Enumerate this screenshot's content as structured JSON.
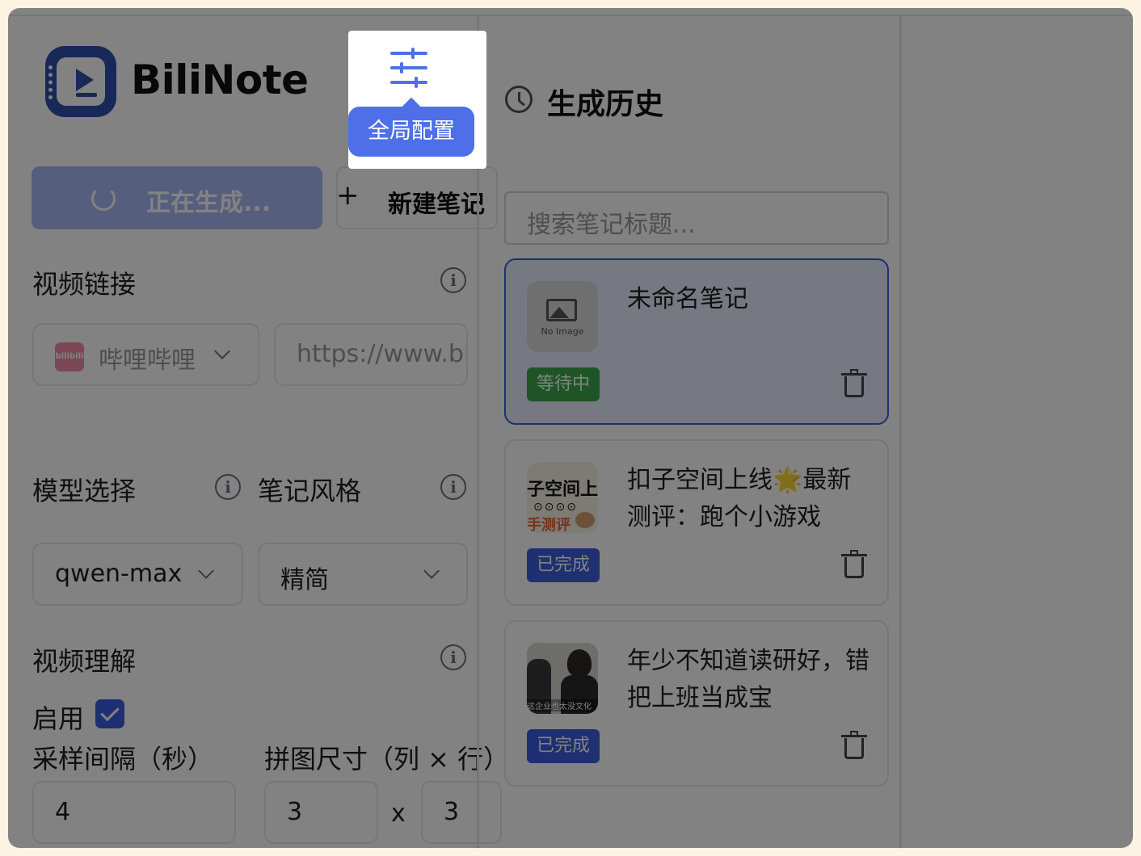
{
  "app": {
    "name": "BiliNote"
  },
  "header": {
    "settings_tooltip": "全局配置"
  },
  "actions": {
    "generating_label": "正在生成...",
    "new_note_label": "新建笔记",
    "plus": "+"
  },
  "form": {
    "video_link": {
      "label": "视频链接",
      "platform": {
        "selected": "哔哩哔哩",
        "logo_text": "bilibili"
      },
      "url_value": "https://www.bilibili.com/"
    },
    "model": {
      "label": "模型选择",
      "selected": "qwen-max"
    },
    "style": {
      "label": "笔记风格",
      "selected": "精简"
    },
    "video_understanding": {
      "label": "视频理解",
      "enable_label": "启用",
      "enabled": true,
      "interval_label": "采样间隔（秒）",
      "interval_value": "4",
      "grid_label": "拼图尺寸（列 × 行）",
      "grid_cols": "3",
      "grid_rows": "3",
      "times": "x"
    }
  },
  "history": {
    "title": "生成历史",
    "search_placeholder": "搜索笔记标题...",
    "items": [
      {
        "title": "未命名笔记",
        "status": "等待中",
        "thumb_text": "No Image"
      },
      {
        "title": "扣子空间上线🌟最新测评：跑个小游戏",
        "status": "已完成",
        "thumb_text_1": "子空间上",
        "thumb_text_2": "⊙⊙⊙⊙",
        "thumb_text_3": "手测评"
      },
      {
        "title": "年少不知道读研好，错把上班当成宝",
        "status": "已完成",
        "thumb_caption": "这企业也太没文化"
      }
    ]
  },
  "colors": {
    "primary": "#3b5fdd",
    "accent": "#4e6fe8",
    "waiting": "#3ea84c",
    "brand": "#2e4fae"
  }
}
